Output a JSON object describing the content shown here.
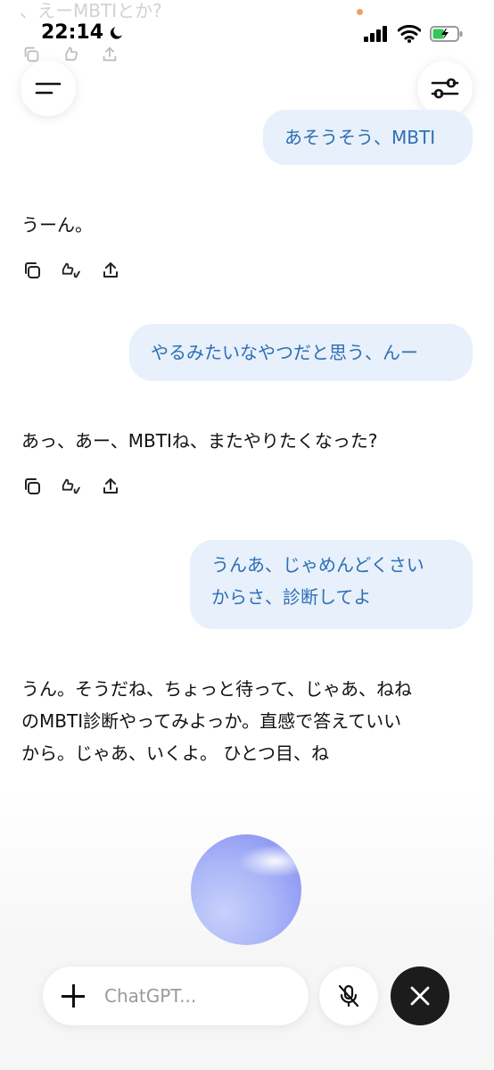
{
  "status_bar": {
    "time": "22:14"
  },
  "previous": {
    "text": "、えーMBTIとか?"
  },
  "messages": [
    {
      "role": "user",
      "text": "あそうそう、MBTI"
    },
    {
      "role": "assistant",
      "text": "うーん。"
    },
    {
      "role": "user",
      "text": "やるみたいなやつだと思う、んー"
    },
    {
      "role": "assistant",
      "text": "あっ、あー、MBTIね、またやりたくなった?"
    },
    {
      "role": "user",
      "line1": "うんあ、じゃめんどくさい",
      "line2": "からさ、診断してよ"
    },
    {
      "role": "assistant",
      "line1": "うん。そうだね、ちょっと待って、じゃあ、ねね",
      "line2": "のMBTI診断やってみよっか。直感で答えていい",
      "line3_main": "から。じゃあ、いくよ。 ひとつ目、ね",
      "line3_fading": "ね"
    }
  ],
  "composer": {
    "placeholder": "ChatGPT..."
  },
  "icons": {
    "menu": "menu-icon",
    "settings": "sliders-icon",
    "copy": "copy-icon",
    "feedback": "thumbs-icon",
    "share": "share-icon",
    "mic_off": "mic-off-icon",
    "close": "close-icon"
  },
  "colors": {
    "user_bubble": "#e7f0fb",
    "user_text": "#2e6fb3",
    "orb": "#7d88f0"
  }
}
